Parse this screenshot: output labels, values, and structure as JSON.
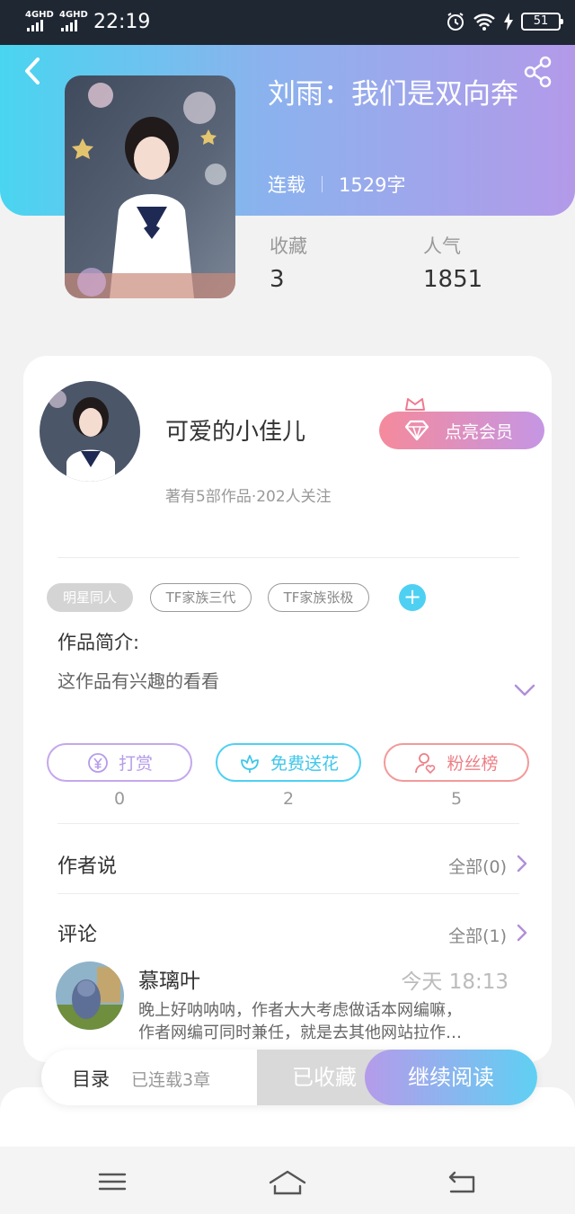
{
  "status_bar": {
    "signal_1": "4GHD",
    "signal_2": "4GHD",
    "time": "22:19",
    "battery": "51",
    "icons": [
      "alarm-icon",
      "wifi-icon",
      "charging-icon",
      "battery-icon"
    ]
  },
  "header": {
    "back_icon": "back-arrow-icon",
    "share_icon": "share-icon"
  },
  "book": {
    "title": "刘雨：我们是双向奔",
    "status": "连载",
    "word_count": "1529字",
    "favorites_label": "收藏",
    "favorites_value": "3",
    "popularity_label": "人气",
    "popularity_value": "1851"
  },
  "author": {
    "name": "可爱的小佳儿",
    "stats": "著有5部作品·202人关注",
    "vip_button": "点亮会员"
  },
  "tags": {
    "items": [
      "明星同人",
      "TF家族三代",
      "TF家族张极"
    ],
    "add_label": "+"
  },
  "intro": {
    "heading": "作品简介:",
    "text": "这作品有兴趣的看看"
  },
  "actions": {
    "reward_label": "打赏",
    "reward_count": "0",
    "flower_label": "免费送花",
    "flower_count": "2",
    "fans_label": "粉丝榜",
    "fans_count": "5"
  },
  "author_says": {
    "heading": "作者说",
    "more": "全部(0)"
  },
  "comments": {
    "heading": "评论",
    "more": "全部(1)",
    "items": [
      {
        "user": "慕璃叶",
        "time": "今天 18:13",
        "line1": "晚上好呐呐呐，作者大大考虑做话本网编嘛，",
        "line2": "作者网编可同时兼任，就是去其他网站拉作…"
      }
    ]
  },
  "bottom_bar": {
    "toc": "目录",
    "chapters": "已连载3章",
    "collected": "已收藏",
    "continue": "继续阅读"
  },
  "colors": {
    "accent_cyan": "#49d5f0",
    "accent_purple": "#b39ae9",
    "vip_pink": "#f58a9c"
  }
}
